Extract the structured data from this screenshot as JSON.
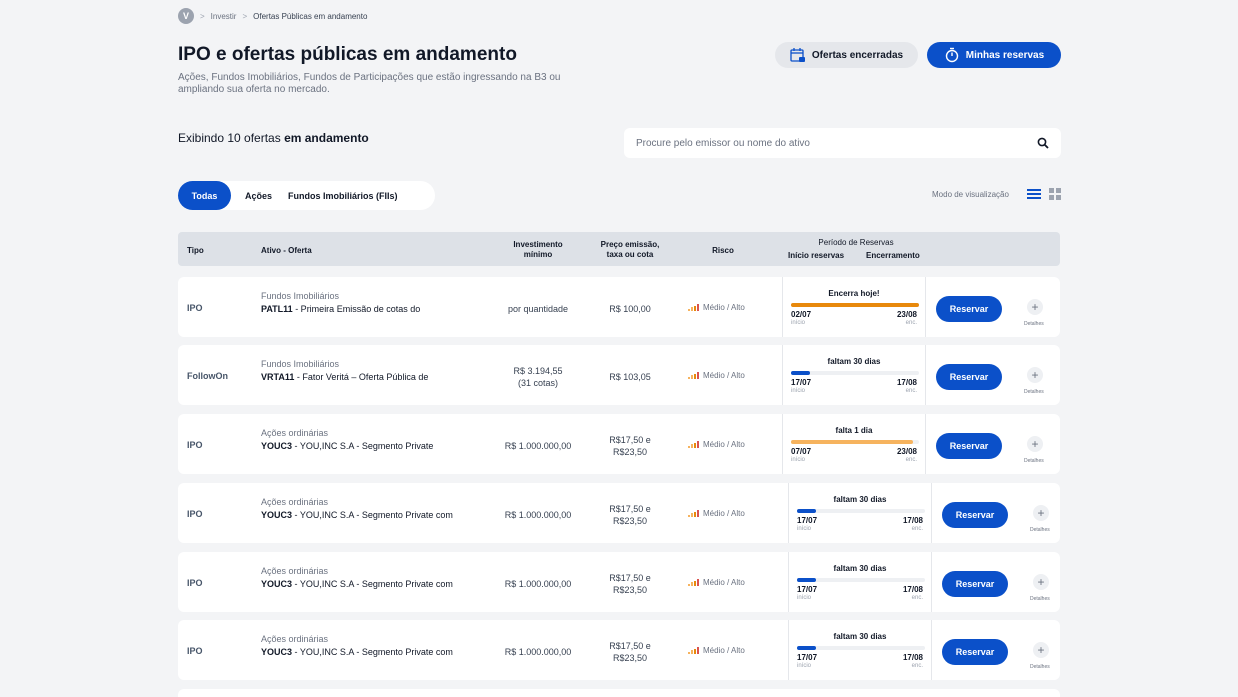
{
  "breadcrumb": {
    "avatar": "V",
    "items": [
      "Investir",
      "Ofertas Públicas em andamento"
    ]
  },
  "header": {
    "title": "IPO e ofertas públicas em andamento",
    "subtitle": "Ações, Fundos Imobiliários, Fundos de Participações que estão ingressando na B3 ou ampliando sua oferta no mercado.",
    "btn_closed": "Ofertas encerradas",
    "btn_reservas": "Minhas reservas"
  },
  "count": {
    "prefix": "Exibindo 10 ofertas",
    "bold": "em andamento"
  },
  "search": {
    "placeholder": "Procure pelo emissor ou nome do ativo"
  },
  "filters": [
    "Todas",
    "Ações",
    "Fundos Imobiliários (FIIs)"
  ],
  "view_mode_label": "Modo de visualização",
  "table_header": {
    "tipo": "Tipo",
    "ativo": "Ativo - Oferta",
    "inv_1": "Investimento",
    "inv_2": "mínimo",
    "preco_1": "Preço emissão,",
    "preco_2": "taxa ou cota",
    "risco": "Risco",
    "periodo": "Período de Reservas",
    "inicio": "Início reservas",
    "encerramento": "Encerramento"
  },
  "rows": [
    {
      "tipo": "IPO",
      "cat": "Fundos Imobiliários",
      "ticker": "PATL11",
      "desc": " - Primeira Emissão de cotas do",
      "inv_1": "por quantidade",
      "inv_2": "",
      "price_1": "R$ 100,00",
      "price_2": "",
      "risk": "Médio / Alto",
      "ptitle": "Encerra hoje!",
      "progress": 1.0,
      "bar_color": "#e8890c",
      "d1": "02/07",
      "d2": "23/08",
      "l1": "início",
      "l2": "enc.",
      "btn": "Reservar",
      "det": "Detalhes"
    },
    {
      "tipo": "FollowOn",
      "cat": "Fundos Imobiliários",
      "ticker": "VRTA11",
      "desc": " - Fator Veritá – Oferta Pública de",
      "inv_1": "R$ 3.194,55",
      "inv_2": "(31 cotas)",
      "price_1": "R$ 103,05",
      "price_2": "",
      "risk": "Médio / Alto",
      "ptitle": "faltam 30 dias",
      "progress": 0.15,
      "bar_color": "#0b50c9",
      "d1": "17/07",
      "d2": "17/08",
      "l1": "início",
      "l2": "enc.",
      "btn": "Reservar",
      "det": "Detalhes"
    },
    {
      "tipo": "IPO",
      "cat": "Ações ordinárias",
      "ticker": "YOUC3",
      "desc": " - YOU,INC S.A - Segmento Private",
      "inv_1": "R$ 1.000.000,00",
      "inv_2": "",
      "price_1": "R$17,50 e",
      "price_2": "R$23,50",
      "risk": "Médio / Alto",
      "ptitle": "falta 1 dia",
      "progress": 0.95,
      "bar_color": "#f6b35e",
      "d1": "07/07",
      "d2": "23/08",
      "l1": "início",
      "l2": "enc.",
      "btn": "Reservar",
      "det": "Detalhes"
    },
    {
      "tipo": "IPO",
      "cat": "Ações ordinárias",
      "ticker": "YOUC3",
      "desc": " - YOU,INC S.A - Segmento Private com",
      "inv_1": "R$ 1.000.000,00",
      "inv_2": "",
      "price_1": "R$17,50 e",
      "price_2": "R$23,50",
      "risk": "Médio / Alto",
      "ptitle": "faltam 30 dias",
      "progress": 0.15,
      "bar_color": "#0b50c9",
      "d1": "17/07",
      "d2": "17/08",
      "l1": "início",
      "l2": "enc.",
      "btn": "Reservar",
      "det": "Detalhes"
    },
    {
      "tipo": "IPO",
      "cat": "Ações ordinárias",
      "ticker": "YOUC3",
      "desc": " - YOU,INC S.A - Segmento Private com",
      "inv_1": "R$ 1.000.000,00",
      "inv_2": "",
      "price_1": "R$17,50 e",
      "price_2": "R$23,50",
      "risk": "Médio / Alto",
      "ptitle": "faltam 30 dias",
      "progress": 0.15,
      "bar_color": "#0b50c9",
      "d1": "17/07",
      "d2": "17/08",
      "l1": "início",
      "l2": "enc.",
      "btn": "Reservar",
      "det": "Detalhes"
    },
    {
      "tipo": "IPO",
      "cat": "Ações ordinárias",
      "ticker": "YOUC3",
      "desc": " - YOU,INC S.A - Segmento Private com",
      "inv_1": "R$ 1.000.000,00",
      "inv_2": "",
      "price_1": "R$17,50 e",
      "price_2": "R$23,50",
      "risk": "Médio / Alto",
      "ptitle": "faltam 30 dias",
      "progress": 0.15,
      "bar_color": "#0b50c9",
      "d1": "17/07",
      "d2": "17/08",
      "l1": "início",
      "l2": "enc.",
      "btn": "Reservar",
      "det": "Detalhes"
    }
  ],
  "colors": {
    "primary": "#0b50c9",
    "risk_low": "#f6b35e",
    "risk_mid": "#e8890c",
    "risk_high": "#d9534f"
  }
}
